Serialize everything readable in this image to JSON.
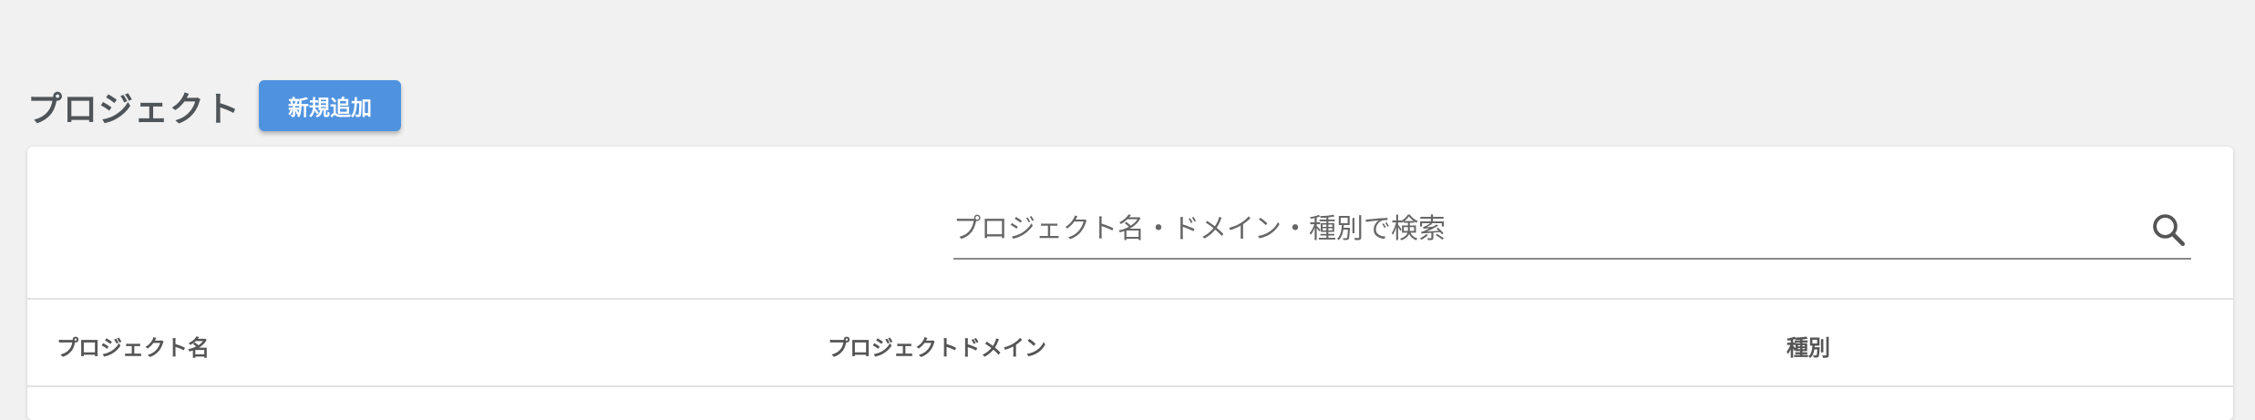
{
  "header": {
    "title": "プロジェクト",
    "add_button_label": "新規追加"
  },
  "search": {
    "placeholder": "プロジェクト名・ドメイン・種別で検索",
    "value": ""
  },
  "table": {
    "columns": [
      "プロジェクト名",
      "プロジェクトドメイン",
      "種別"
    ]
  },
  "icons": {
    "search": "search-icon"
  },
  "colors": {
    "accent": "#4f93e0",
    "background": "#f1f1f1"
  }
}
